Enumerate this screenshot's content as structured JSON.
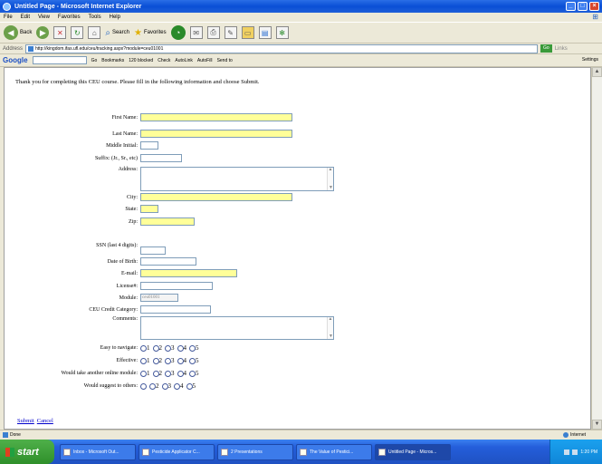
{
  "window": {
    "title": "Untitled Page - Microsoft Internet Explorer"
  },
  "menu": [
    "File",
    "Edit",
    "View",
    "Favorites",
    "Tools",
    "Help"
  ],
  "toolbar": {
    "back": "Back",
    "search": "Search",
    "favorites": "Favorites"
  },
  "address": {
    "label": "Address",
    "url": "http://kingdom.ifas.ufl.edu/ceu/tracking.aspx?module=ceu01001",
    "go": "Go",
    "links": "Links"
  },
  "google": {
    "logo": "Google",
    "go": "Go",
    "bookmarks": "Bookmarks",
    "blocked": "120 blocked",
    "check": "Check",
    "autolink": "AutoLink",
    "autofill": "AutoFill",
    "sendto": "Send to",
    "settings": "Settings"
  },
  "page": {
    "intro": "Thank you for completing this CEU course. Please fill in the following information and choose Submit.",
    "fields": {
      "first_name": "First Name:",
      "last_name": "Last Name:",
      "middle_initial": "Middle Initial:",
      "suffix": "Suffix: (Jr., Sr., etc)",
      "address": "Address:",
      "city": "City:",
      "state": "State:",
      "zip": "Zip:",
      "ssn": "SSN (last 4 digits):",
      "dob": "Date of Birth:",
      "email": "E-mail:",
      "license": "License#:",
      "module": "Module:",
      "module_value": "ceu01001",
      "credit_category": "CEU Credit Category:",
      "comments": "Comments:"
    },
    "surveys": [
      {
        "label": "Easy to navigate:",
        "options": [
          "1",
          "2",
          "3",
          "4",
          "5"
        ]
      },
      {
        "label": "Effective:",
        "options": [
          "1",
          "2",
          "3",
          "4",
          "5"
        ]
      },
      {
        "label": "Would take another online module:",
        "options": [
          "1",
          "2",
          "3",
          "4",
          "5"
        ]
      },
      {
        "label": "Would suggest to others:",
        "options": [
          "",
          "2",
          "3",
          "4",
          "5"
        ]
      }
    ],
    "submit": "Submit",
    "cancel": "Cancel"
  },
  "status": {
    "text": "Done",
    "zone": "Internet"
  },
  "taskbar": {
    "start": "start",
    "tasks": [
      "Inbox - Microsoft Out...",
      "Pesticide Applicator C...",
      "2 Presentations",
      "The Value of Pestici...",
      "Untitled Page - Micros..."
    ],
    "clock": "1:20 PM"
  },
  "colors": {
    "required_field": "#ffff99",
    "link": "#0000cc",
    "titlebar": "#0a4fd6"
  }
}
